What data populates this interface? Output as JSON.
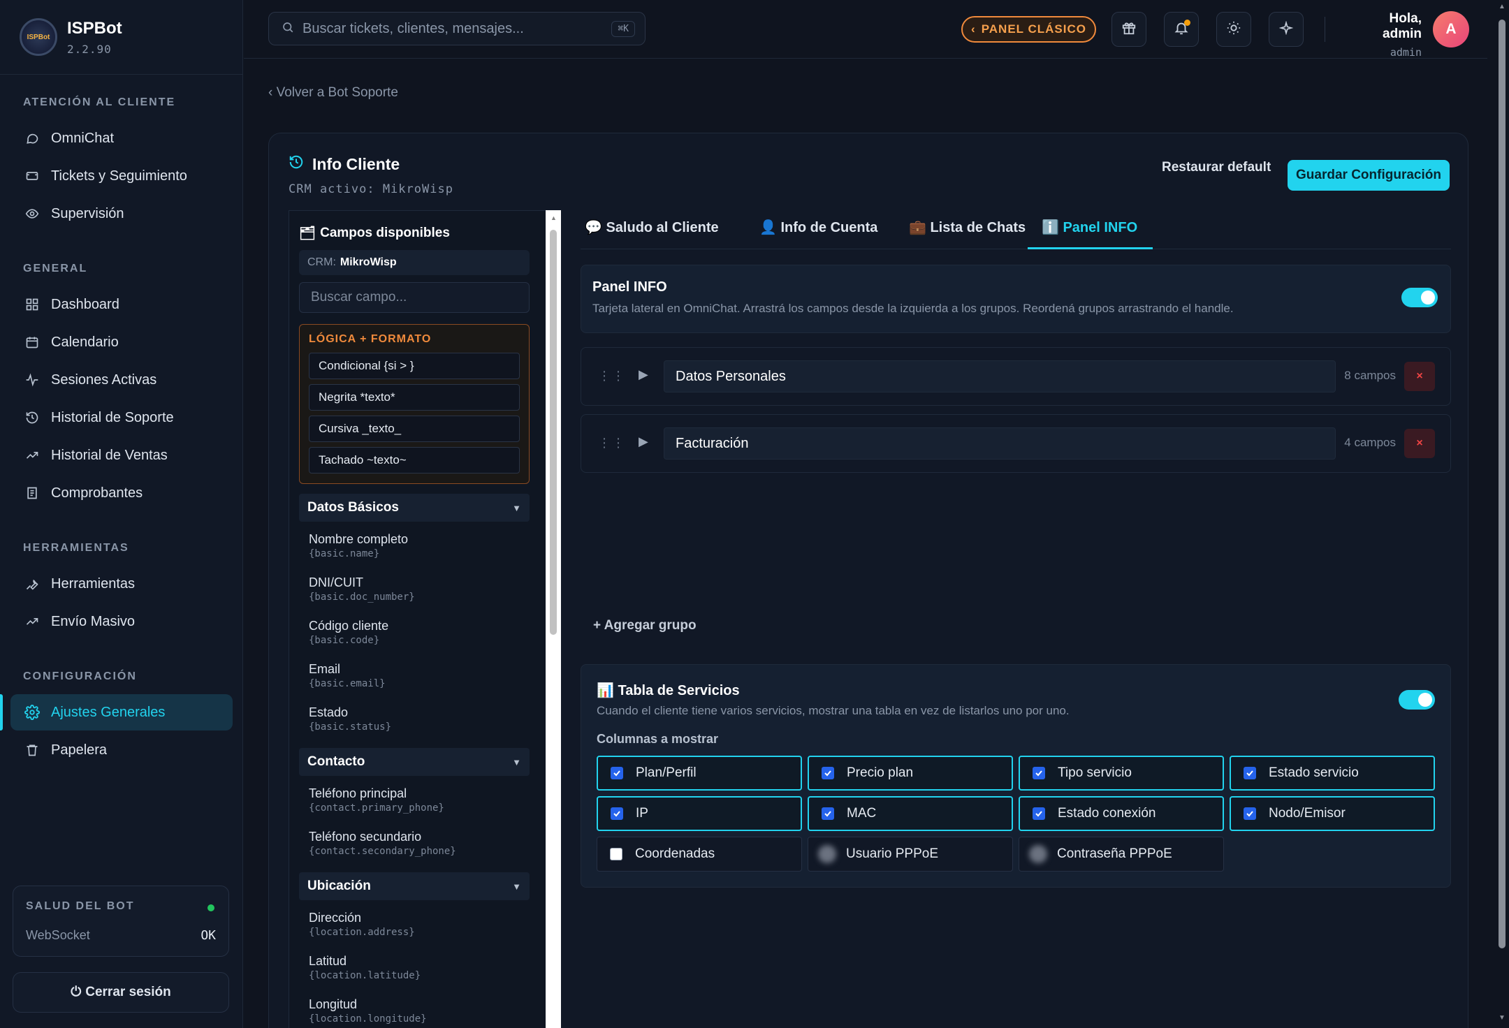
{
  "brand": {
    "name": "ISPBot",
    "version": "2.2.90",
    "logo_text": "ISPBot"
  },
  "sidebar": {
    "sections": [
      {
        "title": "ATENCIÓN AL CLIENTE",
        "items": [
          {
            "label": "OmniChat",
            "icon": "chat-bubble-icon"
          },
          {
            "label": "Tickets y Seguimiento",
            "icon": "ticket-icon"
          },
          {
            "label": "Supervisión",
            "icon": "eye-icon"
          }
        ]
      },
      {
        "title": "GENERAL",
        "items": [
          {
            "label": "Dashboard",
            "icon": "grid-icon"
          },
          {
            "label": "Calendario",
            "icon": "calendar-icon"
          },
          {
            "label": "Sesiones Activas",
            "icon": "activity-icon"
          },
          {
            "label": "Historial de Soporte",
            "icon": "history-icon"
          },
          {
            "label": "Historial de Ventas",
            "icon": "trending-up-icon"
          },
          {
            "label": "Comprobantes",
            "icon": "receipt-icon"
          }
        ]
      },
      {
        "title": "HERRAMIENTAS",
        "items": [
          {
            "label": "Herramientas",
            "icon": "wrench-icon"
          },
          {
            "label": "Envío Masivo",
            "icon": "trending-up-icon"
          }
        ]
      },
      {
        "title": "CONFIGURACIÓN",
        "items": [
          {
            "label": "Ajustes Generales",
            "icon": "gear-icon",
            "active": true
          },
          {
            "label": "Papelera",
            "icon": "trash-icon"
          }
        ]
      }
    ],
    "health": {
      "title": "SALUD DEL BOT",
      "label": "WebSocket",
      "value": "OK"
    },
    "logout_label": "Cerrar sesión"
  },
  "topbar": {
    "search_placeholder": "Buscar tickets, clientes, mensajes...",
    "shortcut": "⌘K",
    "classic_label": "PANEL CLÁSICO",
    "greeting": "Hola, admin",
    "role": "admin",
    "avatar_letter": "A"
  },
  "page": {
    "back_label": "Volver a Bot Soporte",
    "title": "Info Cliente",
    "subtitle": "CRM activo: MikroWisp",
    "restore_label": "Restaurar default",
    "save_label": "Guardar Configuración"
  },
  "fields": {
    "title": "Campos disponibles",
    "crm_prefix": "CRM:",
    "crm_name": "MikroWisp",
    "search_placeholder": "Buscar campo...",
    "logic_title": "LÓGICA + FORMATO",
    "logic_items": [
      "Condicional {si > }",
      "Negrita *texto*",
      "Cursiva _texto_",
      "Tachado ~texto~"
    ],
    "groups": [
      {
        "name": "Datos Básicos",
        "items": [
          {
            "label": "Nombre completo",
            "key": "{basic.name}"
          },
          {
            "label": "DNI/CUIT",
            "key": "{basic.doc_number}"
          },
          {
            "label": "Código cliente",
            "key": "{basic.code}"
          },
          {
            "label": "Email",
            "key": "{basic.email}"
          },
          {
            "label": "Estado",
            "key": "{basic.status}"
          }
        ]
      },
      {
        "name": "Contacto",
        "items": [
          {
            "label": "Teléfono principal",
            "key": "{contact.primary_phone}"
          },
          {
            "label": "Teléfono secundario",
            "key": "{contact.secondary_phone}"
          }
        ]
      },
      {
        "name": "Ubicación",
        "items": [
          {
            "label": "Dirección",
            "key": "{location.address}"
          },
          {
            "label": "Latitud",
            "key": "{location.latitude}"
          },
          {
            "label": "Longitud",
            "key": "{location.longitude}"
          }
        ]
      }
    ]
  },
  "tabs": [
    {
      "label": "💬 Saludo al Cliente"
    },
    {
      "label": "👤 Info de Cuenta"
    },
    {
      "label": "💼 Lista de Chats"
    },
    {
      "label": "ℹ️ Panel INFO",
      "active": true
    }
  ],
  "panel_info": {
    "title": "Panel INFO",
    "description": "Tarjeta lateral en OmniChat. Arrastrá los campos desde la izquierda a los grupos. Reordená grupos arrastrando el handle.",
    "enabled": true,
    "groups": [
      {
        "name": "Datos Personales",
        "count": "8 campos"
      },
      {
        "name": "Facturación",
        "count": "4 campos"
      }
    ],
    "add_group_label": "+ Agregar grupo"
  },
  "services_table": {
    "title": "📊 Tabla de Servicios",
    "description": "Cuando el cliente tiene varios servicios, mostrar una tabla en vez de listarlos uno por uno.",
    "enabled": true,
    "columns_label": "Columnas a mostrar",
    "columns": [
      {
        "label": "Plan/Perfil",
        "state": "on"
      },
      {
        "label": "Precio plan",
        "state": "on"
      },
      {
        "label": "Tipo servicio",
        "state": "on"
      },
      {
        "label": "Estado servicio",
        "state": "on"
      },
      {
        "label": "IP",
        "state": "on"
      },
      {
        "label": "MAC",
        "state": "on"
      },
      {
        "label": "Estado conexión",
        "state": "on"
      },
      {
        "label": "Nodo/Emisor",
        "state": "on"
      },
      {
        "label": "Coordenadas",
        "state": "off"
      },
      {
        "label": "Usuario PPPoE",
        "state": "blur"
      },
      {
        "label": "Contraseña PPPoE",
        "state": "blur"
      }
    ]
  },
  "colors": {
    "accent": "#22d3ee",
    "warning": "#f08a3c",
    "danger": "#ef4444",
    "ok": "#22c55e"
  }
}
